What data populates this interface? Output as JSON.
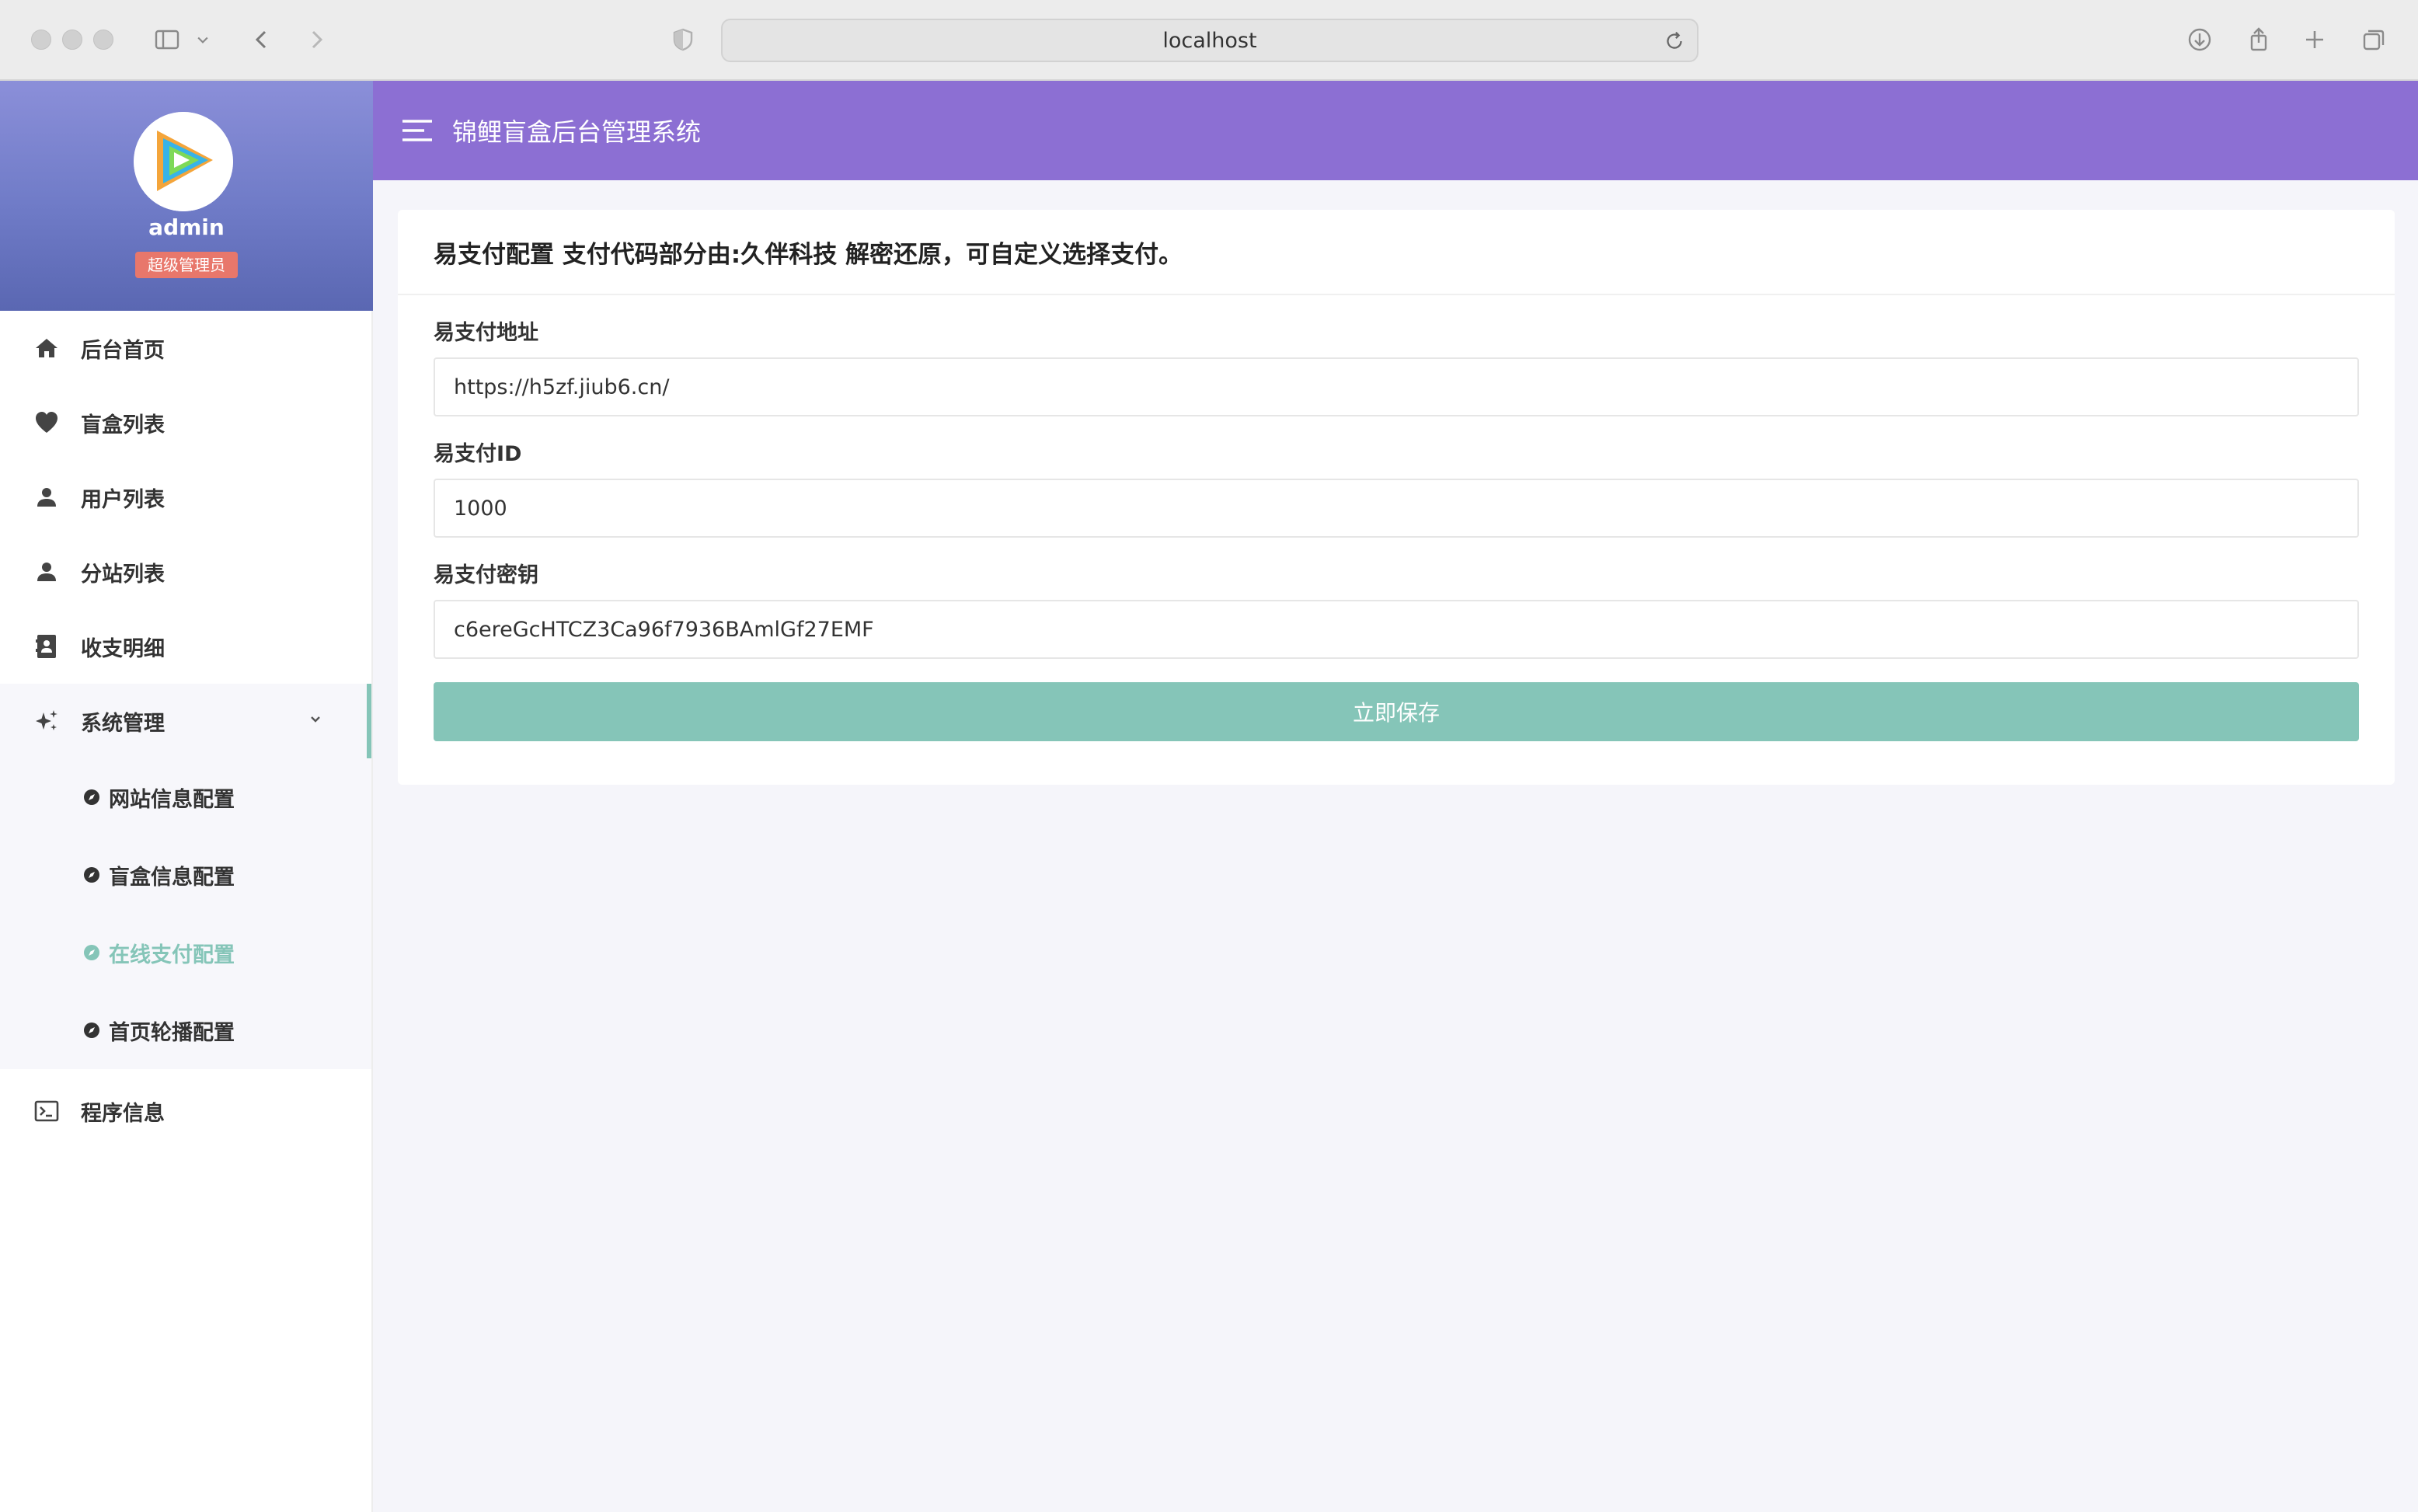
{
  "browser": {
    "url": "localhost"
  },
  "sidebar": {
    "username": "admin",
    "role": "超级管理员",
    "items": [
      {
        "label": "后台首页",
        "icon": "home-icon"
      },
      {
        "label": "盲盒列表",
        "icon": "heart-icon"
      },
      {
        "label": "用户列表",
        "icon": "user-icon"
      },
      {
        "label": "分站列表",
        "icon": "user-icon"
      },
      {
        "label": "收支明细",
        "icon": "contact-card-icon"
      },
      {
        "label": "系统管理",
        "icon": "sparkle-icon",
        "expanded": true
      },
      {
        "label": "程序信息",
        "icon": "terminal-icon"
      }
    ],
    "submenu": [
      {
        "label": "网站信息配置",
        "active": false
      },
      {
        "label": "盲盒信息配置",
        "active": false
      },
      {
        "label": "在线支付配置",
        "active": true
      },
      {
        "label": "首页轮播配置",
        "active": false
      }
    ],
    "accent_color": "#85c5b8"
  },
  "topbar": {
    "title": "锦鲤盲盒后台管理系统",
    "color": "#8c6fd3"
  },
  "form": {
    "header": "易支付配置 支付代码部分由:久伴科技 解密还原，可自定义选择支付。",
    "fields": [
      {
        "label": "易支付地址",
        "value": "https://h5zf.jiub6.cn/"
      },
      {
        "label": "易支付ID",
        "value": "1000"
      },
      {
        "label": "易支付密钥",
        "value": "c6ereGcHTCZ3Ca96f7936BAmlGf27EMF"
      }
    ],
    "save_label": "立即保存"
  }
}
